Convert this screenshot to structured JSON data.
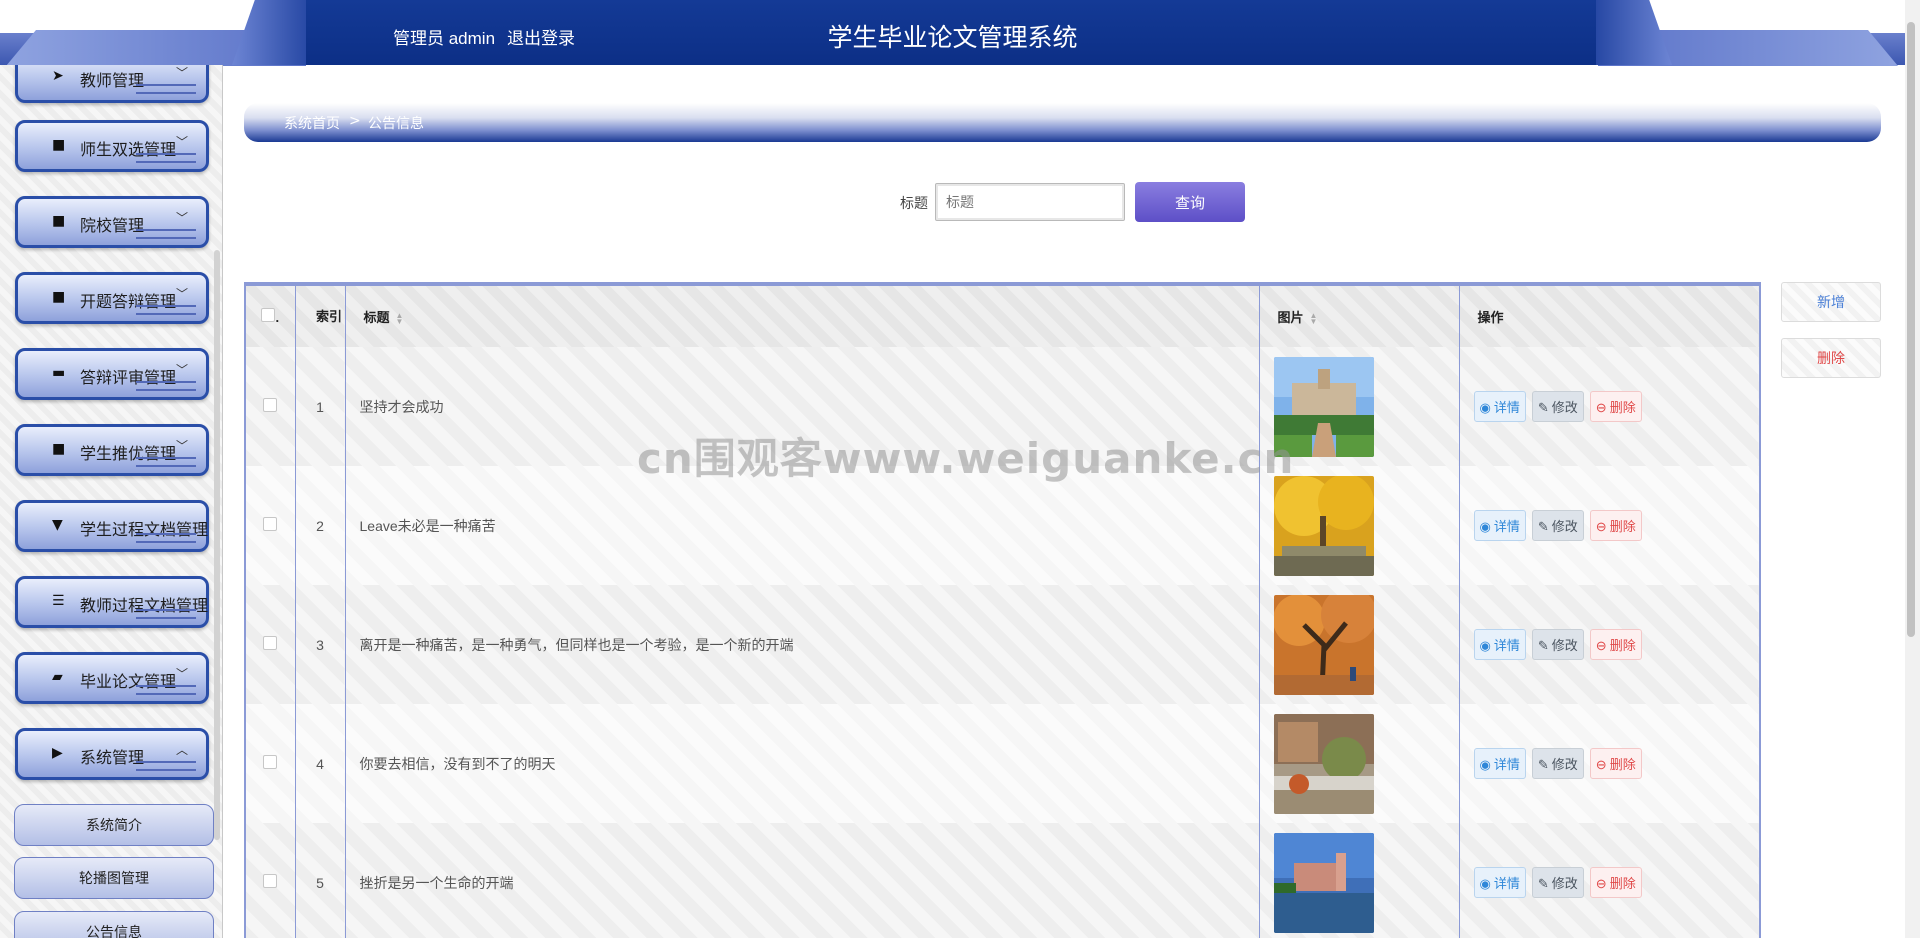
{
  "header": {
    "admin_label": "管理员 admin",
    "logout_label": "退出登录",
    "title": "学生毕业论文管理系统"
  },
  "sidebar": {
    "items": [
      {
        "label": "教师管理",
        "icon": "send-icon",
        "arrow": "﹀"
      },
      {
        "label": "师生双选管理",
        "icon": "grid-icon",
        "arrow": "﹀"
      },
      {
        "label": "院校管理",
        "icon": "grid-icon",
        "arrow": "﹀"
      },
      {
        "label": "开题答辩管理",
        "icon": "grid-icon",
        "arrow": "﹀"
      },
      {
        "label": "答辩评审管理",
        "icon": "comment-icon",
        "arrow": "﹀"
      },
      {
        "label": "学生推优管理",
        "icon": "grid-icon",
        "arrow": "﹀"
      },
      {
        "label": "学生过程文档管理",
        "icon": "brush-icon",
        "arrow": ""
      },
      {
        "label": "教师过程文档管理",
        "icon": "list-icon",
        "arrow": ""
      },
      {
        "label": "毕业论文管理",
        "icon": "cart-icon",
        "arrow": "﹀"
      },
      {
        "label": "系统管理",
        "icon": "video-icon",
        "arrow": "︿"
      }
    ],
    "subitems": [
      {
        "label": "系统简介"
      },
      {
        "label": "轮播图管理"
      },
      {
        "label": "公告信息"
      }
    ]
  },
  "breadcrumb": {
    "home": "系统首页",
    "separator": ">",
    "current": "公告信息"
  },
  "search": {
    "label": "标题",
    "placeholder": "标题",
    "button": "查询"
  },
  "actions": {
    "add": "新增",
    "delete": "删除"
  },
  "table": {
    "columns": {
      "select": ".",
      "index": "索引",
      "title": "标题",
      "image": "图片",
      "ops": "操作"
    },
    "op_labels": {
      "detail": "详情",
      "edit": "修改",
      "delete": "删除"
    },
    "rows": [
      {
        "index": "1",
        "title": "坚持才会成功"
      },
      {
        "index": "2",
        "title": "Leave未必是一种痛苦"
      },
      {
        "index": "3",
        "title": "离开是一种痛苦，是一种勇气，但同样也是一个考验，是一个新的开端"
      },
      {
        "index": "4",
        "title": "你要去相信，没有到不了的明天"
      },
      {
        "index": "5",
        "title": "挫折是另一个生命的开端"
      }
    ]
  },
  "watermark": "cn围观客www.weiguanke.cn",
  "colors": {
    "header_blue": "#0c2f86",
    "accent_purple": "#6a5acd",
    "detail_blue": "#2f87d8",
    "delete_red": "#e04848"
  }
}
